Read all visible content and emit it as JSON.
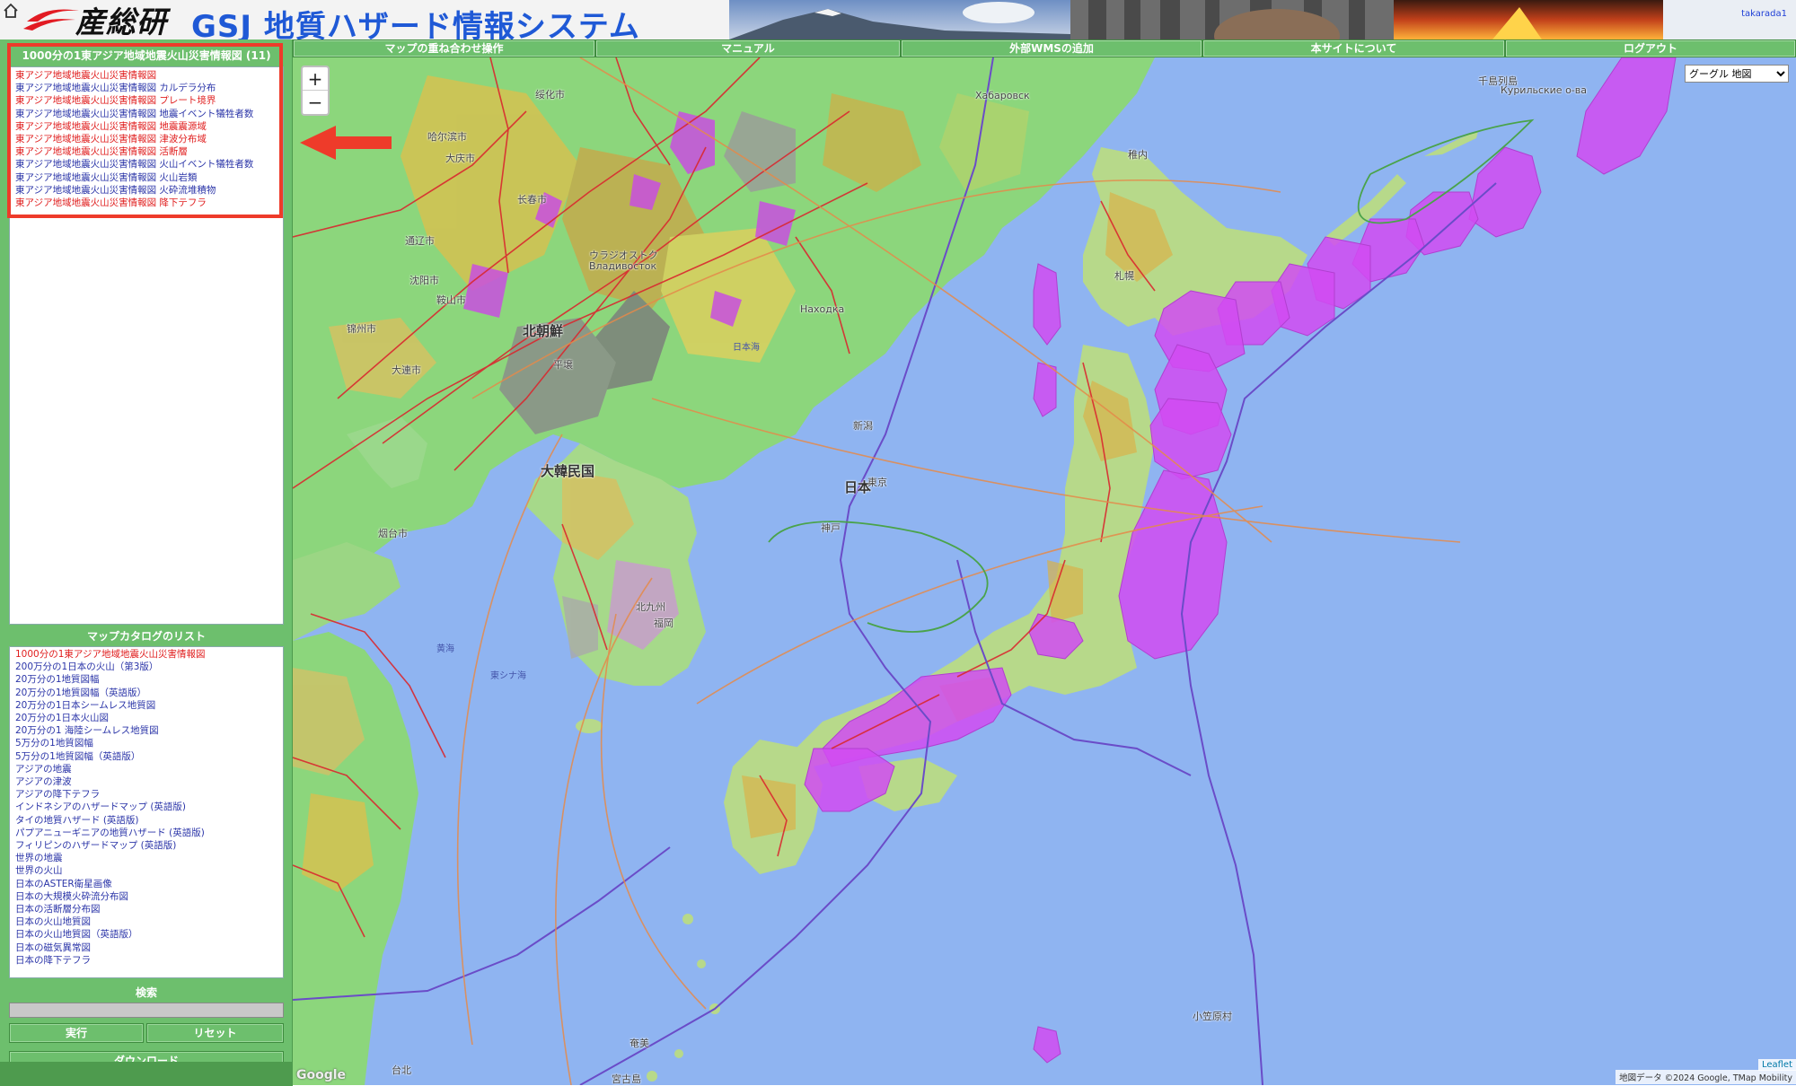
{
  "header": {
    "logo_text": "産総研",
    "site_title": "GSJ 地質ハザード情報システム",
    "user": "takarada1"
  },
  "top_nav": [
    {
      "label": "マップの重ね合わせ操作"
    },
    {
      "label": "マニュアル"
    },
    {
      "label": "外部WMSの追加"
    },
    {
      "label": "本サイトについて"
    },
    {
      "label": "ログアウト"
    }
  ],
  "layers_panel": {
    "title": "1000分の1東アジア地域地震火山災害情報図 (11)",
    "items": [
      {
        "label": "東アジア地域地震火山災害情報図",
        "active": true
      },
      {
        "label": "東アジア地域地震火山災害情報図 カルデラ分布",
        "active": false
      },
      {
        "label": "東アジア地域地震火山災害情報図 プレート境界",
        "active": true
      },
      {
        "label": "東アジア地域地震火山災害情報図 地震イベント犠牲者数",
        "active": false
      },
      {
        "label": "東アジア地域地震火山災害情報図 地震震源域",
        "active": true
      },
      {
        "label": "東アジア地域地震火山災害情報図 津波分布域",
        "active": true
      },
      {
        "label": "東アジア地域地震火山災害情報図 活断層",
        "active": true
      },
      {
        "label": "東アジア地域地震火山災害情報図 火山イベント犠牲者数",
        "active": false
      },
      {
        "label": "東アジア地域地震火山災害情報図 火山岩類",
        "active": false
      },
      {
        "label": "東アジア地域地震火山災害情報図 火砕流堆積物",
        "active": false
      },
      {
        "label": "東アジア地域地震火山災害情報図 降下テフラ",
        "active": true
      }
    ]
  },
  "catalog_panel": {
    "title": "マップカタログのリスト",
    "items": [
      "1000分の1東アジア地域地震火山災害情報図",
      "200万分の1日本の火山（第3版）",
      "20万分の1地質図幅",
      "20万分の1地質図幅（英語版）",
      "20万分の1日本シームレス地質図",
      "20万分の1日本火山図",
      "20万分の1 海陸シームレス地質図",
      "5万分の1地質図幅",
      "5万分の1地質図幅（英語版）",
      "アジアの地震",
      "アジアの津波",
      "アジアの降下テフラ",
      "インドネシアのハザードマップ (英語版)",
      "タイの地質ハザード (英語版)",
      "パプアニューギニアの地質ハザード (英語版)",
      "フィリピンのハザードマップ (英語版)",
      "世界の地震",
      "世界の火山",
      "日本のASTER衛星画像",
      "日本の大規模火砕流分布図",
      "日本の活断層分布図",
      "日本の火山地質図",
      "日本の火山地質図（英語版）",
      "日本の磁気異常図",
      "日本の降下テフラ"
    ],
    "selected_index": 0
  },
  "search": {
    "title": "検索",
    "value": "",
    "run_label": "実行",
    "reset_label": "リセット",
    "download_label": "ダウンロード"
  },
  "map": {
    "zoom_in": "+",
    "zoom_out": "−",
    "basemap_selected": "グーグル 地図",
    "leaflet_attribution": "Leaflet",
    "data_attribution": "地図データ ©2024 Google, TMap Mobility",
    "google_logo": "Google",
    "labels": [
      {
        "text": "北朝鮮",
        "big": true
      },
      {
        "text": "大韓民国",
        "big": true
      },
      {
        "text": "日本",
        "big": true
      },
      {
        "text": "日本海",
        "sea": true
      },
      {
        "text": "東シナ海",
        "sea": true
      },
      {
        "text": "黄海",
        "sea": true
      },
      {
        "text": "東京"
      },
      {
        "text": "神戸"
      },
      {
        "text": "新潟"
      },
      {
        "text": "平壌"
      },
      {
        "text": "大連市"
      },
      {
        "text": "烟台市"
      },
      {
        "text": "沈阳市"
      },
      {
        "text": "长春市"
      },
      {
        "text": "通辽市"
      },
      {
        "text": "锦州市"
      },
      {
        "text": "鞍山市"
      },
      {
        "text": "绥化市"
      },
      {
        "text": "哈尔滨市"
      },
      {
        "text": "大庆市"
      },
      {
        "text": "Владивосток"
      },
      {
        "text": "ウラジオストク"
      },
      {
        "text": "Находка"
      },
      {
        "text": "Хабаровск"
      },
      {
        "text": "稚内"
      },
      {
        "text": "札幌"
      },
      {
        "text": "福岡"
      },
      {
        "text": "北九州"
      },
      {
        "text": "小笠原村"
      },
      {
        "text": "Курильские о-ва"
      },
      {
        "text": "千島列島"
      },
      {
        "text": "宮古島"
      },
      {
        "text": "奄美"
      },
      {
        "text": "台北"
      }
    ]
  },
  "colors": {
    "sidebar_green": "#6dbf6d",
    "ocean": "#8fb4f1",
    "land": "#8cd67c",
    "hazard_zone": "#d14bf2",
    "active_fault": "#d9282f",
    "plate_boundary": "#6a4cc8",
    "highlight": "#ee3b2a",
    "title_blue": "#1f59d6"
  }
}
